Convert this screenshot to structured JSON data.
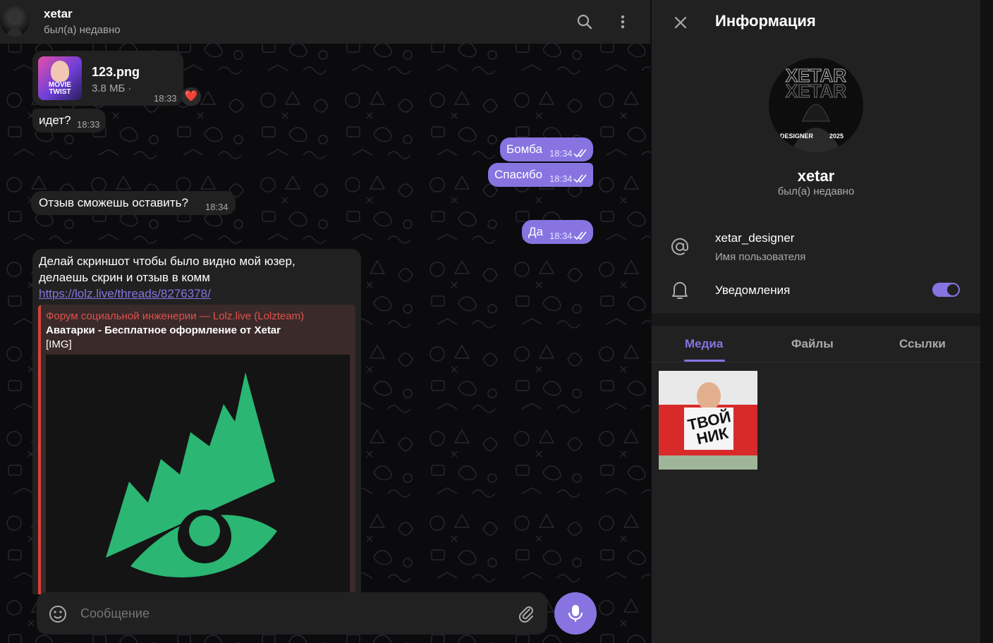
{
  "chat": {
    "contact_name": "xetar",
    "contact_status": "был(а) недавно",
    "messages": {
      "file": {
        "name": "123.png",
        "size": "3.8 МБ ·",
        "time": "18:33",
        "reaction": "❤️"
      },
      "idet": {
        "text": "идет?",
        "time": "18:33"
      },
      "bomba": {
        "text": "Бомба",
        "time": "18:34"
      },
      "spasibo": {
        "text": "Спасибо",
        "time": "18:34"
      },
      "otzyv": {
        "text": "Отзыв сможешь оставить?",
        "time": "18:34"
      },
      "da": {
        "text": "Да",
        "time": "18:34"
      },
      "link_msg": {
        "line1": "Делай скриншот чтобы было видно мой юзер,",
        "line2": "делаешь скрин и отзыв в комм",
        "url": "https://lolz.live/threads/8276378/",
        "preview_site": "Форум социальной инженерии — Lolz.live (Lolzteam)",
        "preview_title": "Аватарки - Бесплатное оформление от Xetar",
        "preview_desc": "[IMG]"
      }
    },
    "thumb_text": "MOVIE TWIST",
    "composer_placeholder": "Сообщение"
  },
  "info": {
    "title": "Информация",
    "avatar_text": {
      "top": "XETAR",
      "left": "DESIGNER",
      "right": "2025"
    },
    "name": "xetar",
    "status": "был(а) недавно",
    "username": "xetar_designer",
    "username_label": "Имя пользователя",
    "notifications_label": "Уведомления",
    "notifications_on": true,
    "tabs": [
      "Медиа",
      "Файлы",
      "Ссылки"
    ],
    "media_caption": "ТВОЙ НИК"
  },
  "colors": {
    "accent": "#8774e1",
    "bubble_in": "#212121",
    "panel": "#212121",
    "link": "#8774e1",
    "preview_site": "#e0524b",
    "preview_bar": "#d9413c",
    "logo_green": "#2bb673"
  }
}
